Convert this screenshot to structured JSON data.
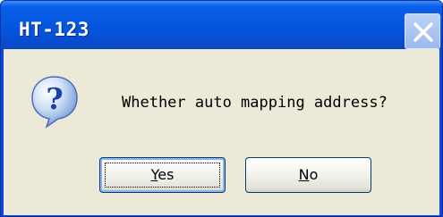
{
  "window": {
    "title": "HT-123",
    "close_icon": "close-icon"
  },
  "dialog": {
    "icon": "question-icon",
    "message": "Whether auto mapping address?"
  },
  "buttons": {
    "yes": {
      "mnemonic": "Y",
      "rest": "es"
    },
    "no": {
      "mnemonic": "N",
      "rest": "o"
    }
  },
  "colors": {
    "titlebar": "#0558e0",
    "client": "#ece9d8",
    "button_border": "#003c74"
  }
}
